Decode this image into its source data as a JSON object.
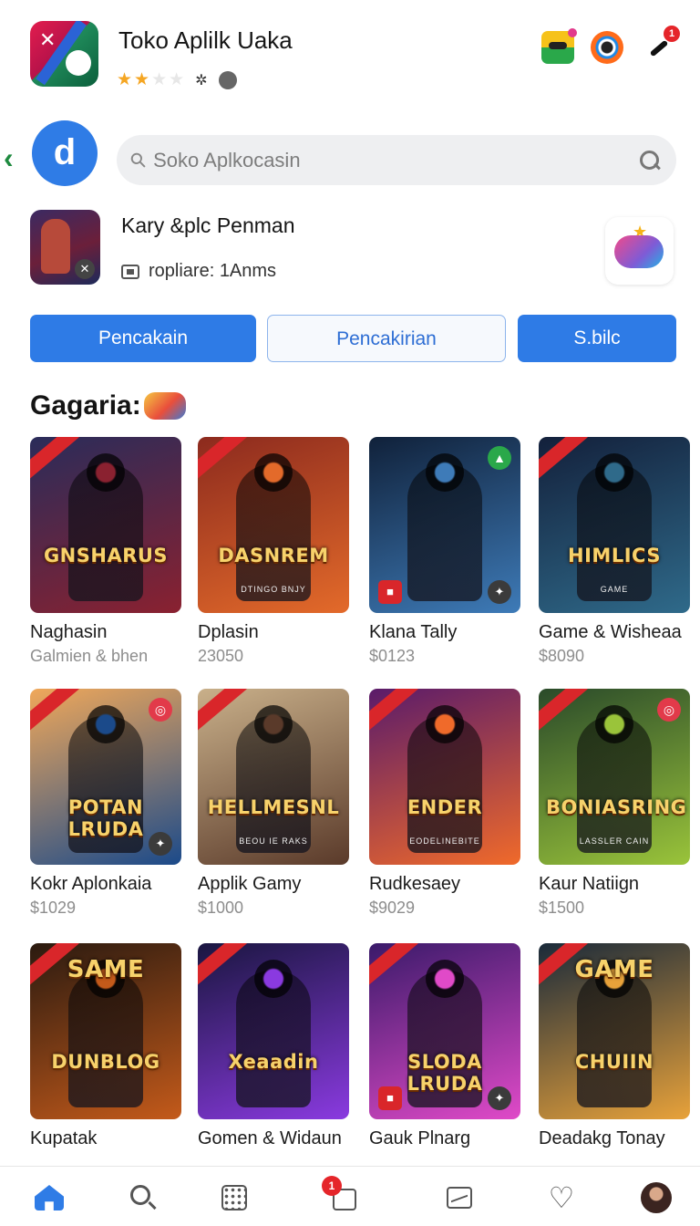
{
  "header": {
    "title": "Toko Aplilk Uaka",
    "rating": {
      "stars_filled": 2,
      "stars_total": 5
    },
    "icons": [
      "game-icon",
      "lens-icon",
      "brush-icon"
    ],
    "notification_count": "1"
  },
  "search": {
    "brand_glyph": "d",
    "placeholder": "Soko Aplkocasin"
  },
  "featured": {
    "title": "Kary &plc Penman",
    "subtitle": "ropliare: 1Anms"
  },
  "buttons": [
    "Pencakain",
    "Pencakirian",
    "S.bilc"
  ],
  "section": {
    "title": "Gagaria:"
  },
  "cards": [
    {
      "name": "Naghasin",
      "price": "Galmien & bhen",
      "logo": "GNSHARUS",
      "sublogo": "",
      "colors": [
        "#2a2c5a",
        "#8a2130"
      ]
    },
    {
      "name": "Dplasin",
      "price": "23050",
      "logo": "DASNREM",
      "sublogo": "DTINGO BNJY",
      "colors": [
        "#8c2a1e",
        "#e36a2a"
      ]
    },
    {
      "name": "Klana Tally",
      "price": "$0123",
      "logo": "",
      "sublogo": "",
      "colors": [
        "#10213a",
        "#3e7bb8"
      ]
    },
    {
      "name": "Game & Wisheaa",
      "price": "$8090",
      "logo": "HIMLICS",
      "sublogo": "GAME",
      "colors": [
        "#13203b",
        "#2f6a8a"
      ]
    },
    {
      "name": "Kokr Aplonkaia",
      "price": "$1029",
      "logo": "POTAN LRUDA",
      "sublogo": "",
      "colors": [
        "#f0a85a",
        "#1b4a8a"
      ]
    },
    {
      "name": "Applik Gamy",
      "price": "$1000",
      "logo": "HELLMESNL",
      "sublogo": "BEOU IE RAKS",
      "colors": [
        "#c9b08a",
        "#5a3a2a"
      ]
    },
    {
      "name": "Rudkesaey",
      "price": "$9029",
      "logo": "ENDER",
      "sublogo": "EODELINEBITE",
      "colors": [
        "#5a1b6a",
        "#f06a2a"
      ]
    },
    {
      "name": "Kaur Natiign",
      "price": "$1500",
      "logo": "BONIASRING",
      "sublogo": "LASSLER CAIN",
      "colors": [
        "#2a4a2a",
        "#9ac43a"
      ]
    },
    {
      "name": "Kupatak",
      "price": "",
      "logo": "DUNBLOG",
      "sublogo": "SAME",
      "colors": [
        "#2a1a10",
        "#c45a1a"
      ]
    },
    {
      "name": "Gomen & Widaun",
      "price": "",
      "logo": "Xeaadin",
      "sublogo": "",
      "colors": [
        "#1a1640",
        "#8a3ae0"
      ]
    },
    {
      "name": "Gauk Plnarg",
      "price": "",
      "logo": "SLODA LRUDA",
      "sublogo": "",
      "colors": [
        "#3a1a6a",
        "#e04ac8"
      ]
    },
    {
      "name": "Deadakg Tonay",
      "price": "",
      "logo": "CHUIIN",
      "sublogo": "GAME",
      "colors": [
        "#1a2a3a",
        "#e8a23a"
      ]
    }
  ],
  "nav": [
    "home-icon",
    "search-icon",
    "apps-grid-icon",
    "bag-icon",
    "gallery-icon",
    "heart-icon",
    "avatar"
  ],
  "nav_badge": "1",
  "colors": {
    "accent": "#2e7be6",
    "star": "#f5a623",
    "badge": "#e5252a"
  }
}
